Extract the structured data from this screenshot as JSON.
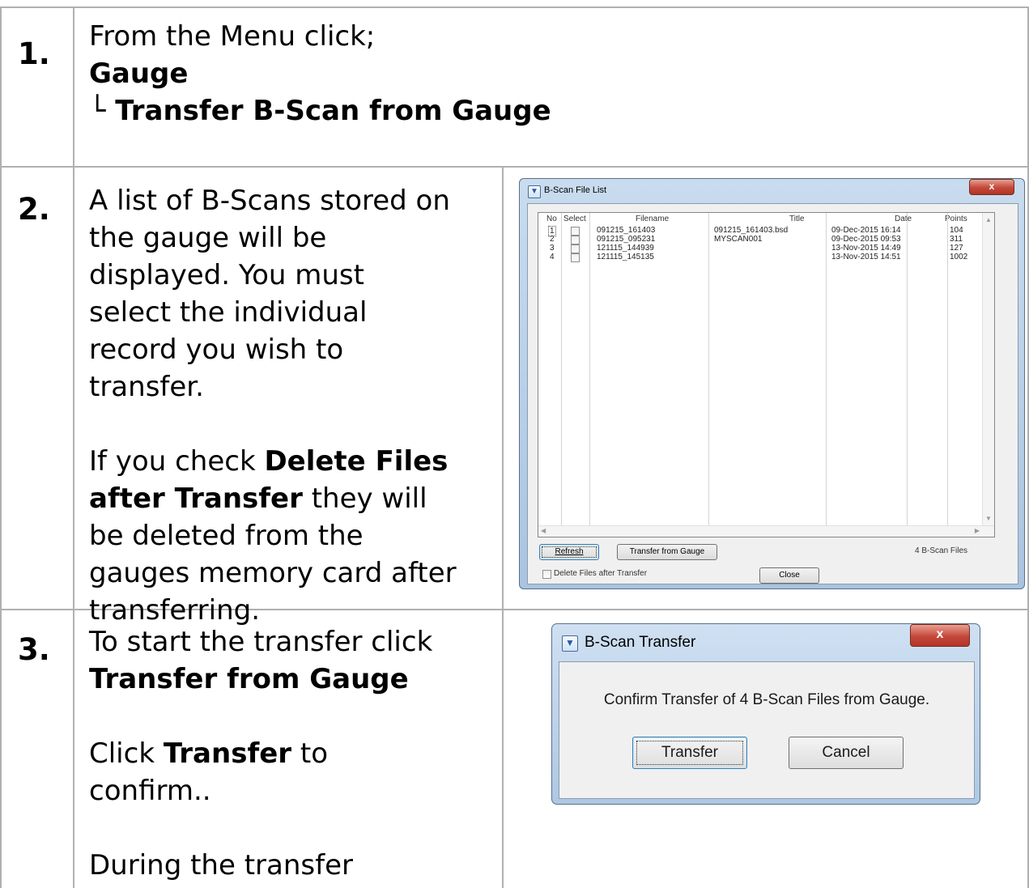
{
  "steps": [
    {
      "number": "1.",
      "line1": "From the Menu click;",
      "line2": "Gauge",
      "line3": "└ Transfer B-Scan from Gauge"
    },
    {
      "number": "2.",
      "lines": [
        "A list of B-Scans stored on",
        "the gauge will be",
        "displayed. You must",
        "select the individual",
        "record you wish to",
        "transfer."
      ],
      "p2_pre": "If you check ",
      "p2_bold1": "Delete Files",
      "p2_bold2": "after Transfer",
      "p2_post": " they will",
      "p2_lines": [
        "be deleted from the",
        "gauges memory card after",
        "transferring."
      ]
    },
    {
      "number": "3.",
      "line1": "To start the transfer click",
      "line2": "Transfer from Gauge",
      "p2_pre": "Click ",
      "p2_bold": "Transfer",
      "p2_post": " to",
      "p2_line2": "confirm..",
      "p3": "During the transfer"
    }
  ],
  "file_list_window": {
    "title": "B-Scan File List",
    "close": "x",
    "columns": [
      "No",
      "Select",
      "Filename",
      "Title",
      "Date",
      "Points"
    ],
    "rows": [
      {
        "no": "1",
        "filename": "091215_161403",
        "title": "091215_161403.bsd",
        "date": "09-Dec-2015 16:14",
        "points": "104"
      },
      {
        "no": "2",
        "filename": "091215_095231",
        "title": "MYSCAN001",
        "date": "09-Dec-2015 09:53",
        "points": "311"
      },
      {
        "no": "3",
        "filename": "121115_144939",
        "title": "",
        "date": "13-Nov-2015 14:49",
        "points": "127"
      },
      {
        "no": "4",
        "filename": "121115_145135",
        "title": "",
        "date": "13-Nov-2015 14:51",
        "points": "1002"
      }
    ],
    "refresh_button": "Refresh",
    "transfer_button": "Transfer from Gauge",
    "file_count": "4 B-Scan Files",
    "delete_checkbox_label": "Delete Files after Transfer",
    "close_button": "Close"
  },
  "transfer_dialog": {
    "title": "B-Scan Transfer",
    "close": "x",
    "message": "Confirm Transfer of 4 B-Scan Files from Gauge.",
    "transfer_button": "Transfer",
    "cancel_button": "Cancel"
  },
  "colors": {
    "border": "#b0b0b0",
    "window_frame": "#a9c4e0",
    "close_button": "#c4483a"
  }
}
